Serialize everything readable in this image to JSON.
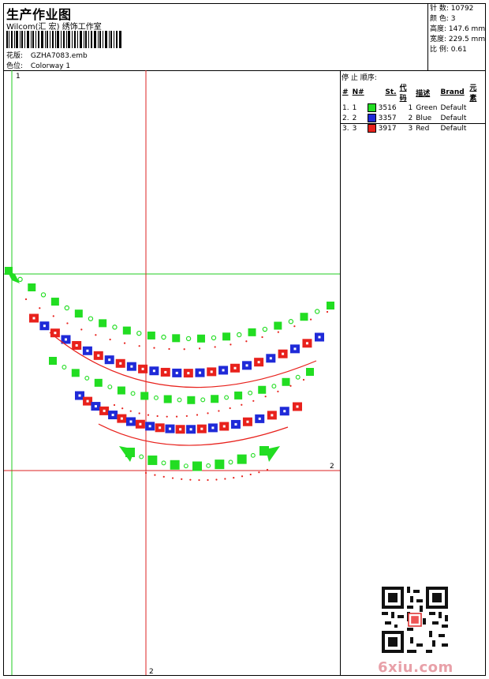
{
  "header": {
    "title": "生产作业图",
    "company": "Wilcom(汇 宏) 绣饰工作室",
    "design": {
      "label": "花版:",
      "value": "GZHA7083.emb"
    },
    "colorway": {
      "label": "色位:",
      "value": "Colorway 1"
    }
  },
  "stats": [
    {
      "label": "针 数:",
      "value": "10792"
    },
    {
      "label": "颜 色:",
      "value": "3"
    },
    {
      "label": "高度:",
      "value": "147.6 mm"
    },
    {
      "label": "宽度:",
      "value": "229.5 mm"
    },
    {
      "label": "比 例:",
      "value": "0.61"
    }
  ],
  "stop_sequence": {
    "heading": "停 止 顺序:",
    "columns": [
      "#",
      "N#",
      "St.",
      "代码",
      "描述",
      "Brand",
      "元素"
    ],
    "rows": [
      {
        "num": "1.",
        "n": "1",
        "color": "#22dd22",
        "code": "3516",
        "st": "1",
        "desc": "Green",
        "brand": "Default"
      },
      {
        "num": "2.",
        "n": "2",
        "color": "#1f2ad8",
        "code": "3357",
        "st": "2",
        "desc": "Blue",
        "brand": "Default"
      },
      {
        "num": "3.",
        "n": "3",
        "color": "#e8211c",
        "code": "3917",
        "st": "3",
        "desc": "Red",
        "brand": "Default"
      }
    ]
  },
  "axes": {
    "v_green": "1",
    "h_red": "2",
    "v_red": "2"
  },
  "colors": {
    "green": "#22dd22",
    "blue": "#1f2ad8",
    "red": "#e8211c",
    "axis_green": "#22cc22",
    "axis_red": "#dd2222"
  },
  "watermark": {
    "site": "6xiu.com"
  }
}
